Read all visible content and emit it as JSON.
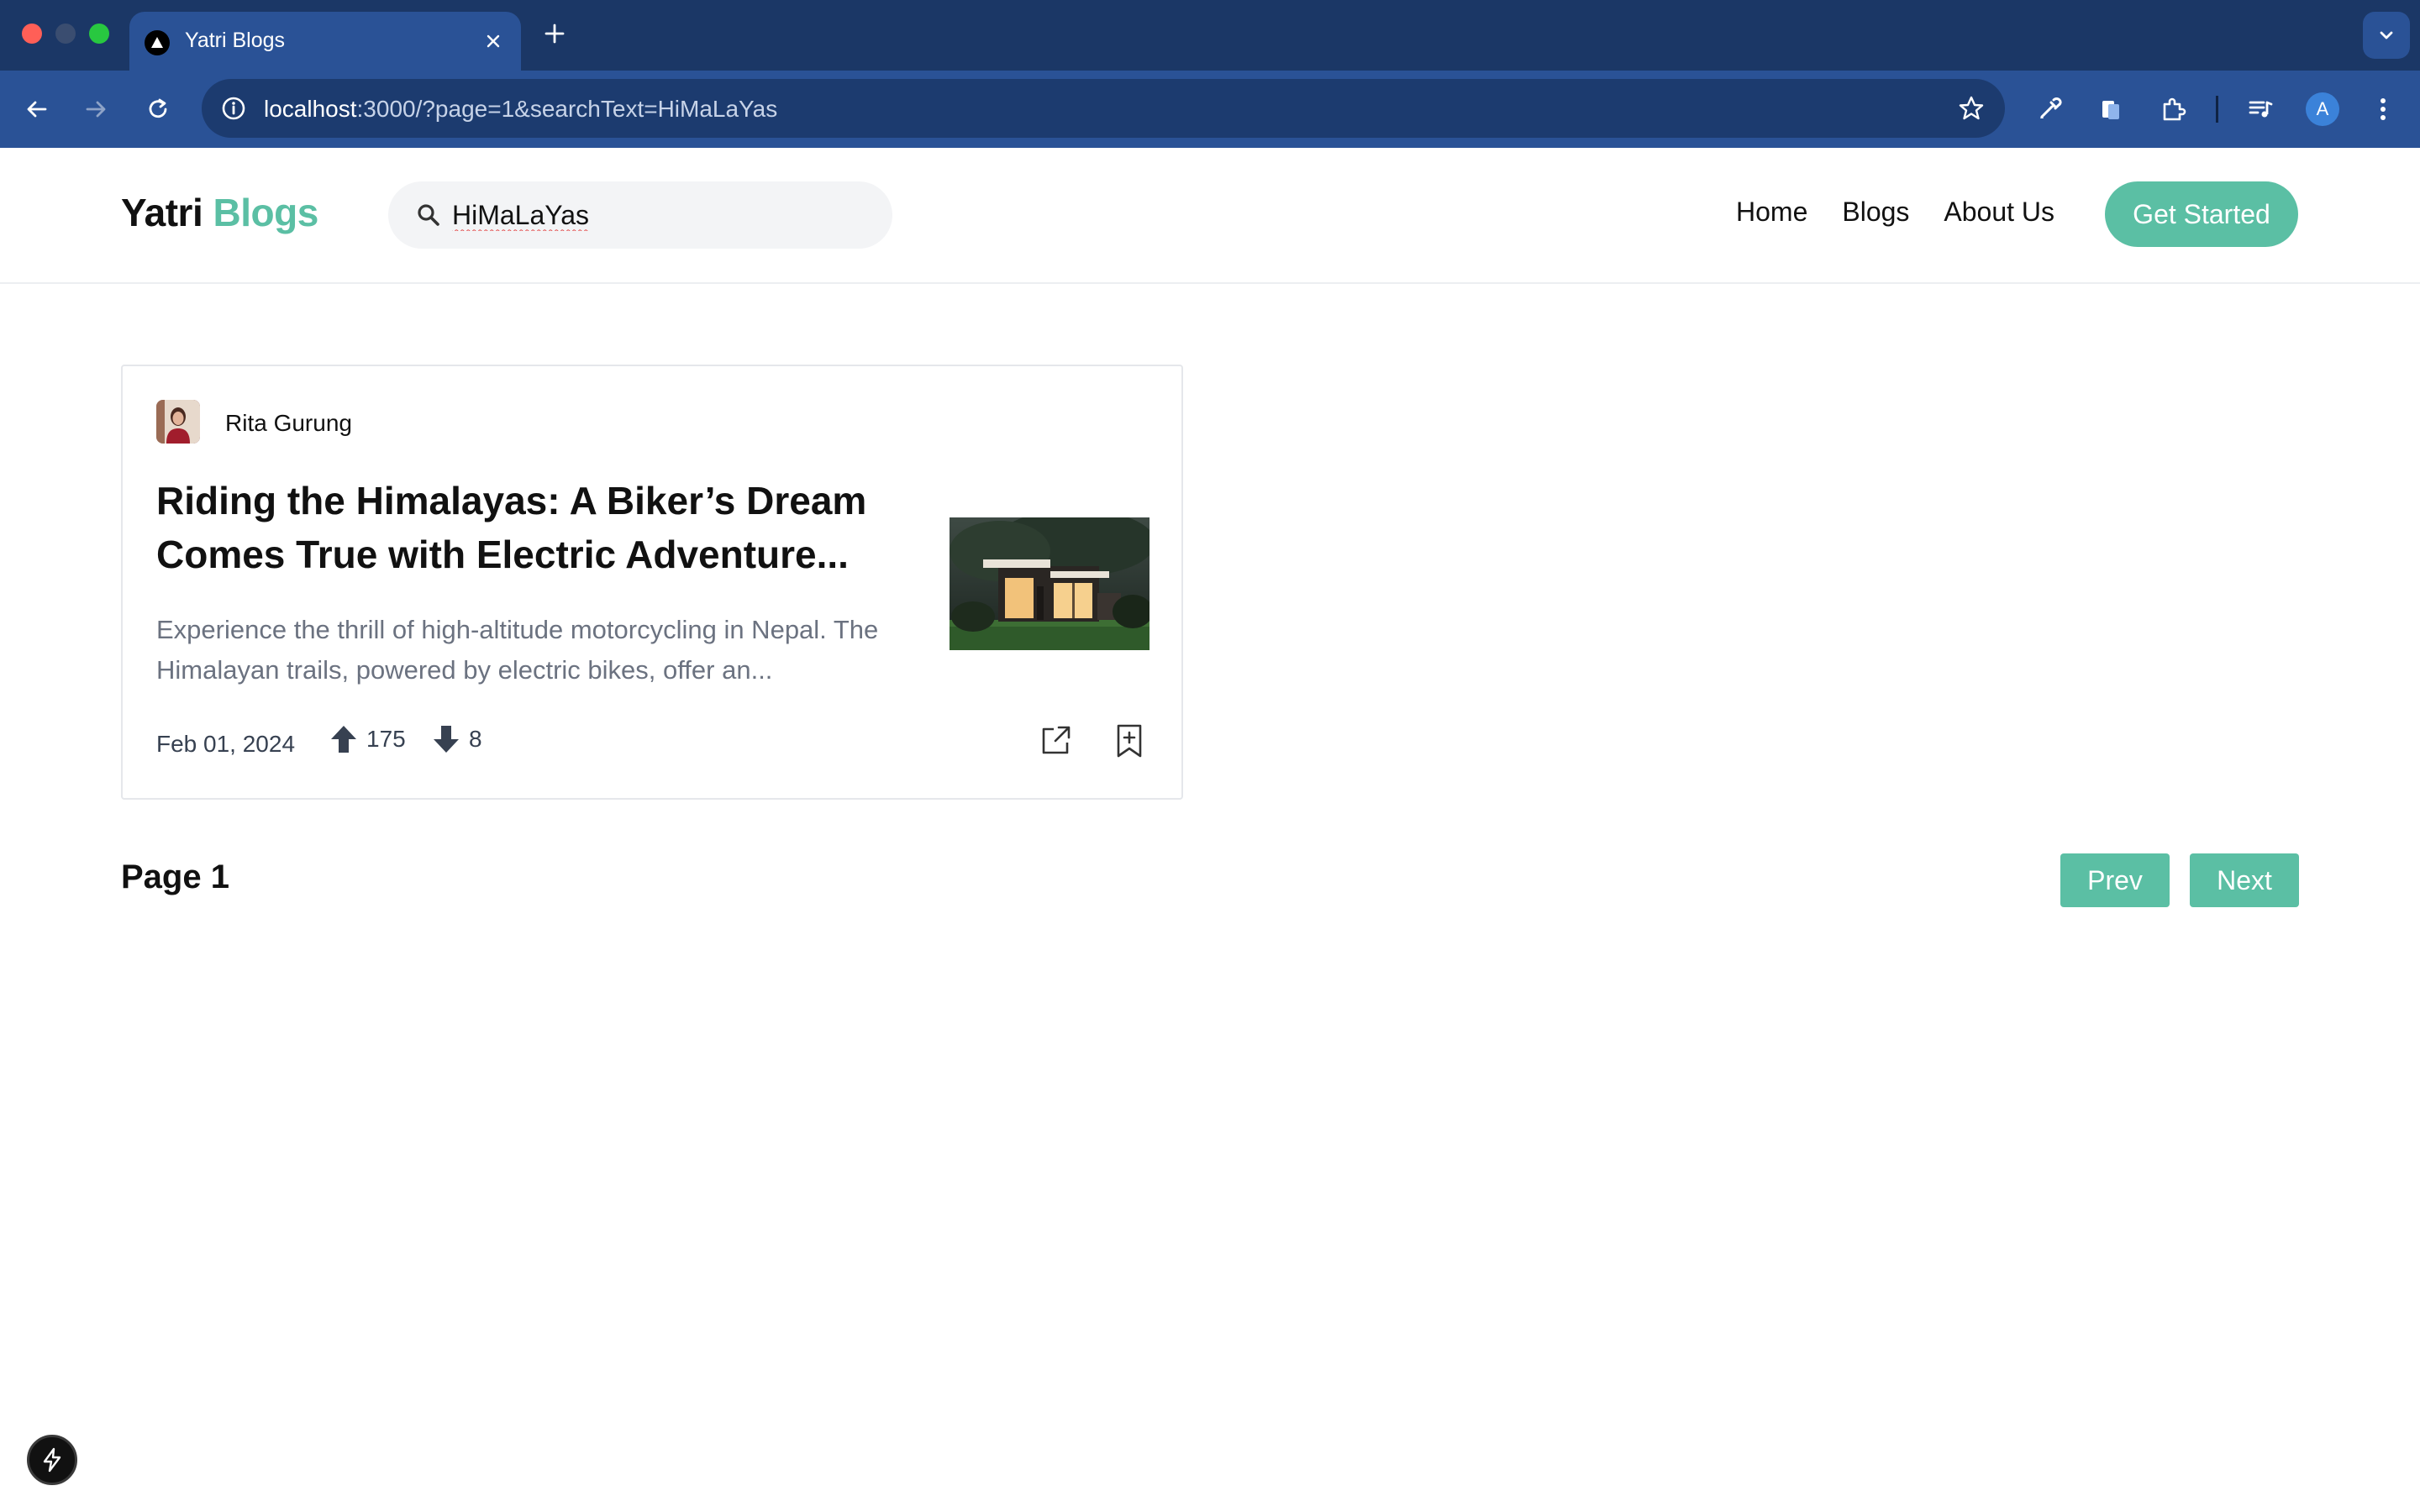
{
  "browser": {
    "tab_title": "Yatri Blogs",
    "url_host": "localhost",
    "url_rest": ":3000/?page=1&searchText=HiMaLaYas",
    "profile_initial": "A",
    "icons": [
      "back-icon",
      "forward-icon",
      "reload-icon",
      "info-icon",
      "star-icon",
      "eyedropper-icon",
      "copy-icon",
      "extensions-icon",
      "media-icon",
      "more-icon"
    ]
  },
  "site": {
    "logo_primary": "Yatri",
    "logo_accent": "Blogs",
    "accent_color": "#5bbfa4",
    "search": {
      "value": "HiMaLaYas",
      "placeholder": ""
    },
    "nav": {
      "home": "Home",
      "blogs": "Blogs",
      "about": "About Us"
    },
    "cta": "Get Started"
  },
  "post": {
    "author": "Rita Gurung",
    "title": "Riding the Himalayas: A Biker’s Dream Comes True with Electric Adventure...",
    "excerpt": "Experience the thrill of high-altitude motorcycling in Nepal. The Himalayan trails, powered by electric bikes, offer an...",
    "date": "Feb 01, 2024",
    "upvotes": "175",
    "downvotes": "8"
  },
  "pagination": {
    "page_label": "Page 1",
    "prev": "Prev",
    "next": "Next"
  }
}
